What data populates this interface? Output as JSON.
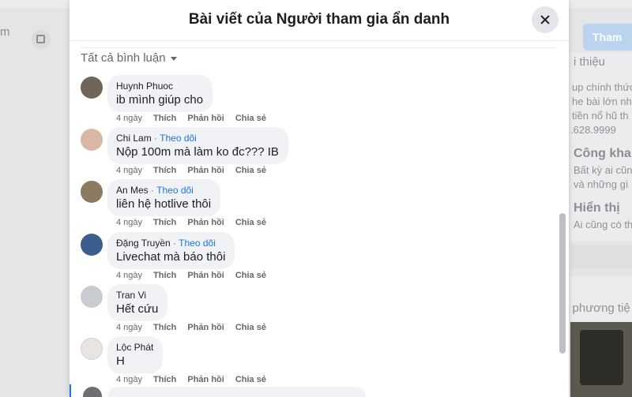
{
  "dialog": {
    "title": "Bài viết của Người tham gia ẩn danh",
    "filter_label": "Tất cả bình luận"
  },
  "background": {
    "left_fragment": "m",
    "join_button": "Tham",
    "right_lines": [
      "i thiệu",
      "up chính thức",
      "he bài lớn nhấ",
      "tiền nổ hũ th",
      ".628.9999",
      "Công khai",
      "Bất kỳ ai cũng",
      "và những gì",
      "Hiển thị",
      "Ai cũng có th",
      "e phương tiệ"
    ]
  },
  "comments": [
    {
      "author": "Huynh Phuoc",
      "follow": "",
      "text": "ib mình giúp cho",
      "time": "4 ngày",
      "avatar_color": "#6f6658"
    },
    {
      "author": "Chi Lam",
      "follow": "Theo dõi",
      "text": "Nộp 100m mà làm ko đc??? IB",
      "time": "4 ngày",
      "avatar_color": "#d9b7a4"
    },
    {
      "author": "An Mes",
      "follow": "Theo dõi",
      "text": "liên hệ hotlive thôi",
      "time": "4 ngày",
      "avatar_color": "#8a7a62"
    },
    {
      "author": "Đặng Truyền",
      "follow": "Theo dõi",
      "text": "Livechat mà báo thôi",
      "time": "4 ngày",
      "avatar_color": "#3a5f8c"
    },
    {
      "author": "Tran Vi",
      "follow": "",
      "text": "Hết cứu",
      "time": "4 ngày",
      "avatar_color": "#c8cbd0"
    },
    {
      "author": "Lộc Phát",
      "follow": "",
      "text": "H",
      "time": "4 ngày",
      "avatar_color": "#e9e4e2"
    }
  ],
  "actions": {
    "like": "Thích",
    "reply": "Phản hồi",
    "share": "Chia sẻ"
  },
  "colors": {
    "link_blue": "#1b74e4",
    "bubble": "#f0f2f5",
    "muted": "#65676b"
  }
}
